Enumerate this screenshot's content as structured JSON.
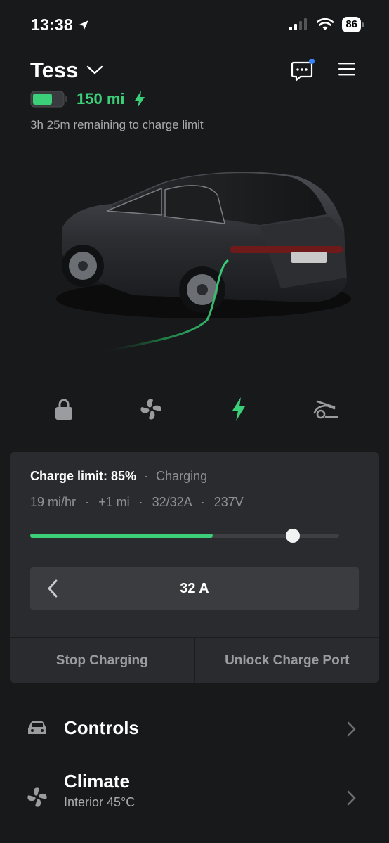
{
  "status_bar": {
    "time": "13:38",
    "battery": "86"
  },
  "header": {
    "car_name": "Tess",
    "range": "150 mi",
    "battery_level": 0.65,
    "remaining": "3h 25m remaining to charge limit"
  },
  "colors": {
    "background": "#18191b",
    "accent_green": "#3ccf7a",
    "panel": "#2a2b2e",
    "notification_dot": "#3b82f6"
  },
  "quick_icons": [
    "lock-icon",
    "fan-icon",
    "bolt-icon",
    "car-lift-icon"
  ],
  "charging": {
    "limit_label": "Charge limit: 85%",
    "separator": "·",
    "state": "Charging",
    "rate": "19 mi/hr",
    "added": "+1 mi",
    "current": "32/32A",
    "voltage": "237V",
    "charge_level": 0.59,
    "charge_limit": 0.85,
    "amps": "32 A",
    "stop_button": "Stop Charging",
    "unlock_button": "Unlock Charge Port"
  },
  "menu": [
    {
      "title": "Controls",
      "subtitle": ""
    },
    {
      "title": "Climate",
      "subtitle": "Interior 45°C"
    }
  ]
}
